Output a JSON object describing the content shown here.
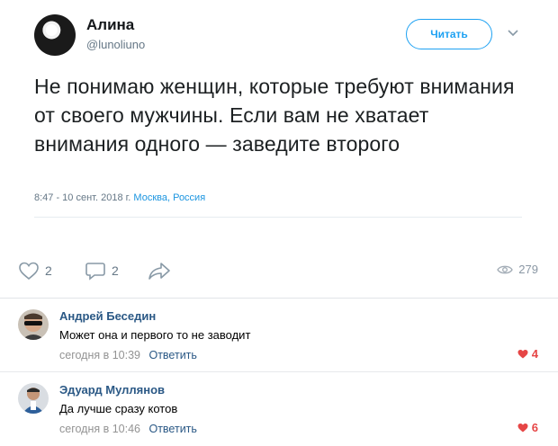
{
  "tweet": {
    "author_name": "Алина",
    "author_handle": "@lunoliuno",
    "follow_label": "Читать",
    "text": "Не понимаю женщин, которые требуют внимания от своего мужчины. Если вам не хватает внимания одного — заведите второго",
    "timestamp": "8:47 - 10 сент. 2018 г.",
    "location": "Москва, Россия"
  },
  "actions": {
    "likes": "2",
    "comments": "2",
    "views": "279"
  },
  "comments": [
    {
      "author": "Андрей Беседин",
      "text": "Может она и первого то не заводит",
      "time": "сегодня в 10:39",
      "reply_label": "Ответить",
      "likes": "4"
    },
    {
      "author": "Эдуард Муллянов",
      "text": "Да лучше сразу котов",
      "time": "сегодня в 10:46",
      "reply_label": "Ответить",
      "likes": "6"
    }
  ],
  "colors": {
    "twitter_blue": "#1da1f2",
    "vk_link": "#2a5885",
    "like_red": "#e64646"
  },
  "icons": [
    "heart-icon",
    "comment-icon",
    "share-icon",
    "eye-icon",
    "chevron-down-icon"
  ]
}
